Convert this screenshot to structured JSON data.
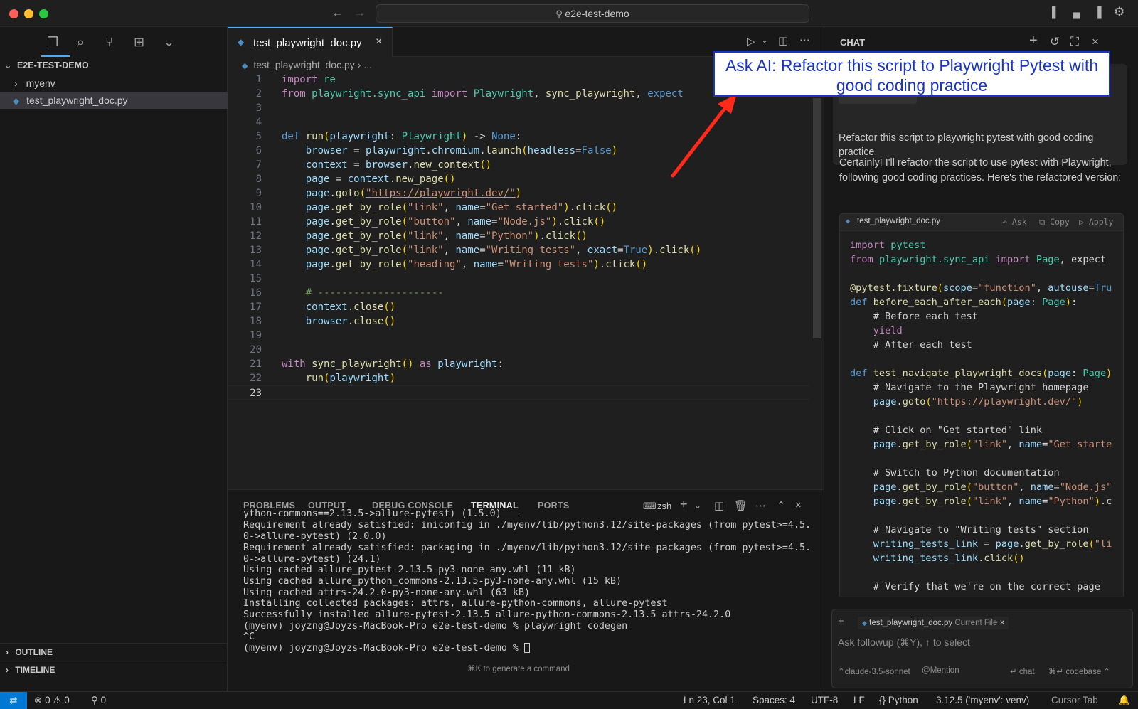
{
  "window": {
    "title": "e2e-test-demo"
  },
  "sidebar": {
    "root_label": "E2E-TEST-DEMO",
    "items": [
      {
        "label": "myenv",
        "type": "folder"
      },
      {
        "label": "test_playwright_doc.py",
        "type": "file"
      }
    ],
    "outline_label": "OUTLINE",
    "timeline_label": "TIMELINE"
  },
  "editor": {
    "tab_label": "test_playwright_doc.py",
    "breadcrumb": {
      "file": "test_playwright_doc.py",
      "more": "..."
    },
    "line_numbers": [
      "1",
      "2",
      "3",
      "4",
      "5",
      "6",
      "7",
      "8",
      "9",
      "10",
      "11",
      "12",
      "13",
      "14",
      "15",
      "16",
      "17",
      "18",
      "19",
      "20",
      "21",
      "22",
      "23"
    ],
    "lines": [
      "import re",
      "from playwright.sync_api import Playwright, sync_playwright, expect",
      "",
      "",
      "def run(playwright: Playwright) -> None:",
      "    browser = playwright.chromium.launch(headless=False)",
      "    context = browser.new_context()",
      "    page = context.new_page()",
      "    page.goto(\"https://playwright.dev/\")",
      "    page.get_by_role(\"link\", name=\"Get started\").click()",
      "    page.get_by_role(\"button\", name=\"Node.js\").click()",
      "    page.get_by_role(\"link\", name=\"Python\").click()",
      "    page.get_by_role(\"link\", name=\"Writing tests\", exact=True).click()",
      "    page.get_by_role(\"heading\", name=\"Writing tests\").click()",
      "",
      "    # ---------------------",
      "    context.close()",
      "    browser.close()",
      "",
      "",
      "with sync_playwright() as playwright:",
      "    run(playwright)",
      ""
    ]
  },
  "panel": {
    "tabs": [
      "PROBLEMS",
      "OUTPUT",
      "DEBUG CONSOLE",
      "TERMINAL",
      "PORTS"
    ],
    "active_tab": "TERMINAL",
    "shell": "zsh",
    "terminal_lines": [
      "ython-commons==2.13.5->allure-pytest) (1.5.0)",
      "Requirement already satisfied: iniconfig in ./myenv/lib/python3.12/site-packages (from pytest>=4.5.",
      "0->allure-pytest) (2.0.0)",
      "Requirement already satisfied: packaging in ./myenv/lib/python3.12/site-packages (from pytest>=4.5.",
      "0->allure-pytest) (24.1)",
      "Using cached allure_pytest-2.13.5-py3-none-any.whl (11 kB)",
      "Using cached allure_python_commons-2.13.5-py3-none-any.whl (15 kB)",
      "Using cached attrs-24.2.0-py3-none-any.whl (63 kB)",
      "Installing collected packages: attrs, allure-python-commons, allure-pytest",
      "Successfully installed allure-pytest-2.13.5 allure-python-commons-2.13.5 attrs-24.2.0",
      "(myenv) joyzng@Joyzs-MacBook-Pro e2e-test-demo % playwright codegen",
      "^C",
      "(myenv) joyzng@Joyzs-MacBook-Pro e2e-test-demo % "
    ],
    "hint": "⌘K to generate a command"
  },
  "chat": {
    "title": "CHAT",
    "user_message": "Refactor this script to playwright pytest with good coding practice",
    "ai_message": "Certainly! I'll refactor the script to use pytest with Playwright, following good coding practices. Here's the refactored version:",
    "code_file": "test_playwright_doc.py",
    "code_actions": [
      "Ask",
      "Copy",
      "Apply"
    ],
    "code_lines": [
      "import pytest",
      "from playwright.sync_api import Page, expect",
      "",
      "@pytest.fixture(scope=\"function\", autouse=Tru",
      "def before_each_after_each(page: Page):",
      "    # Before each test",
      "    yield",
      "    # After each test",
      "",
      "def test_navigate_playwright_docs(page: Page)",
      "    # Navigate to the Playwright homepage",
      "    page.goto(\"https://playwright.dev/\")",
      "",
      "    # Click on \"Get started\" link",
      "    page.get_by_role(\"link\", name=\"Get starte",
      "",
      "    # Switch to Python documentation",
      "    page.get_by_role(\"button\", name=\"Node.js\"",
      "    page.get_by_role(\"link\", name=\"Python\").c",
      "",
      "    # Navigate to \"Writing tests\" section",
      "    writing_tests_link = page.get_by_role(\"li",
      "    writing_tests_link.click()",
      "",
      "    # Verify that we're on the correct page"
    ],
    "context_file": "test_playwright_doc.py",
    "context_tag": "Current File",
    "input_placeholder": "Ask followup (⌘Y), ↑ to select",
    "model": "claude-3.5-sonnet",
    "mention": "Mention",
    "chat_label": "chat",
    "codebase_label": "codebase"
  },
  "annotation": {
    "callout_text": "Ask AI: Refactor this script to Playwright Pytest with good coding practice",
    "arrow_color": "#ff2a1a",
    "box_color": "#1a35c4"
  },
  "statusbar": {
    "errors": "0",
    "warnings": "0",
    "ports": "0",
    "position": "Ln 23, Col 1",
    "spaces": "Spaces: 4",
    "encoding": "UTF-8",
    "eol": "LF",
    "language": "Python",
    "interpreter": "3.12.5 ('myenv': venv)",
    "cursor_tab": "Cursor Tab"
  }
}
